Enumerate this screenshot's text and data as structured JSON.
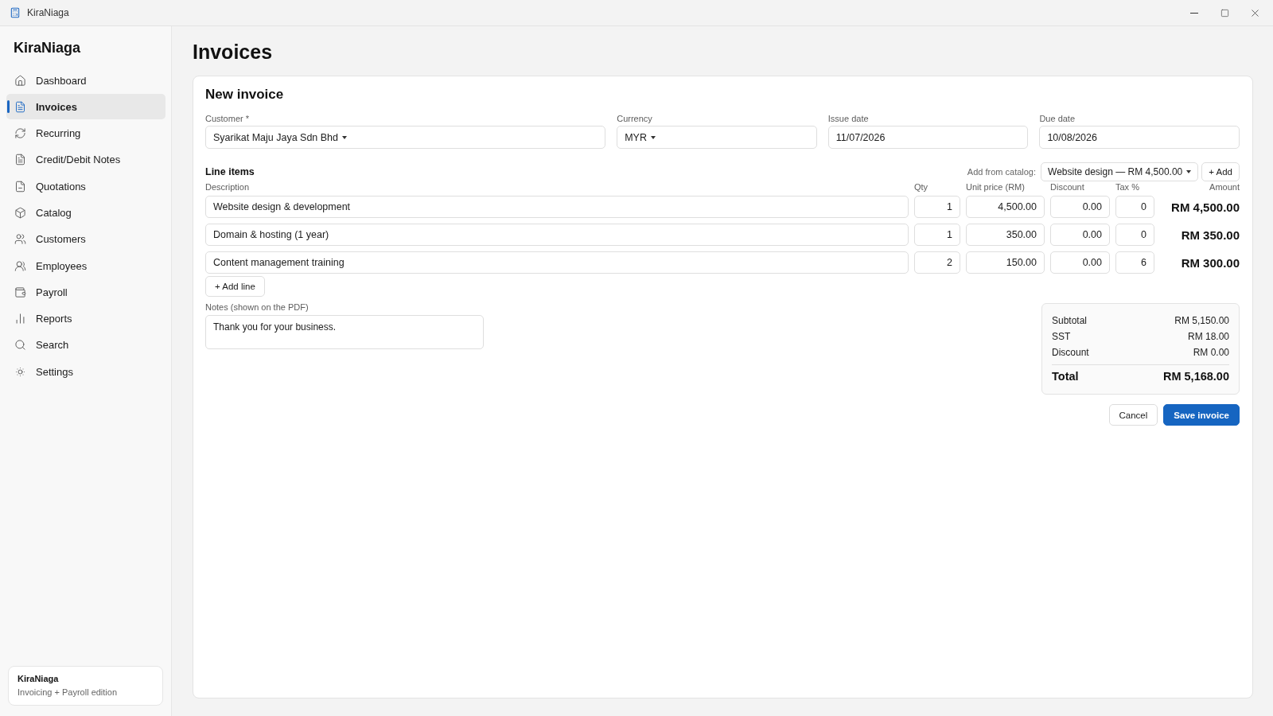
{
  "window": {
    "title": "KiraNiaga"
  },
  "sidebar": {
    "brand": "KiraNiaga",
    "items": [
      {
        "label": "Dashboard",
        "selected": false
      },
      {
        "label": "Invoices",
        "selected": true
      },
      {
        "label": "Recurring",
        "selected": false
      },
      {
        "label": "Credit/Debit Notes",
        "selected": false
      },
      {
        "label": "Quotations",
        "selected": false
      },
      {
        "label": "Catalog",
        "selected": false
      },
      {
        "label": "Customers",
        "selected": false
      },
      {
        "label": "Employees",
        "selected": false
      },
      {
        "label": "Payroll",
        "selected": false
      },
      {
        "label": "Reports",
        "selected": false
      },
      {
        "label": "Search",
        "selected": false
      },
      {
        "label": "Settings",
        "selected": false
      }
    ],
    "footer": {
      "title": "KiraNiaga",
      "subtitle": "Invoicing + Payroll edition"
    }
  },
  "page": {
    "title": "Invoices"
  },
  "form": {
    "title": "New invoice",
    "fields": [
      {
        "label": "Customer *",
        "value": "Syarikat Maju Jaya Sdn Bhd",
        "kind": "select"
      },
      {
        "label": "Currency",
        "value": "MYR",
        "kind": "select"
      },
      {
        "label": "Issue date",
        "value": "11/07/2026",
        "kind": "text"
      },
      {
        "label": "Due date",
        "value": "10/08/2026",
        "kind": "text"
      }
    ],
    "line_items": {
      "title": "Line items",
      "catalog": {
        "label": "Add from catalog:",
        "value": "Website design — RM 4,500.00",
        "button": "+ Add"
      },
      "columns": [
        "Description",
        "Qty",
        "Unit price (RM)",
        "Discount",
        "Tax %",
        "Amount"
      ],
      "rows": [
        {
          "description": "Website design & development",
          "qty": "1",
          "unit_price": "4,500.00",
          "discount": "0.00",
          "tax": "0",
          "amount": "RM 4,500.00"
        },
        {
          "description": "Domain & hosting (1 year)",
          "qty": "1",
          "unit_price": "350.00",
          "discount": "0.00",
          "tax": "0",
          "amount": "RM 350.00"
        },
        {
          "description": "Content management training",
          "qty": "2",
          "unit_price": "150.00",
          "discount": "0.00",
          "tax": "6",
          "amount": "RM 300.00"
        }
      ],
      "add_button": "+ Add line"
    },
    "notes": {
      "label": "Notes (shown on the PDF)",
      "value": "Thank you for your business."
    },
    "totals": {
      "rows": [
        {
          "label": "Subtotal",
          "value": "RM 5,150.00"
        },
        {
          "label": "SST",
          "value": "RM 18.00"
        },
        {
          "label": "Discount",
          "value": "RM 0.00"
        }
      ],
      "total": {
        "label": "Total",
        "value": "RM 5,168.00"
      }
    },
    "actions": [
      {
        "label": "Cancel",
        "kind": "secondary"
      },
      {
        "label": "Save invoice",
        "kind": "primary"
      }
    ]
  }
}
